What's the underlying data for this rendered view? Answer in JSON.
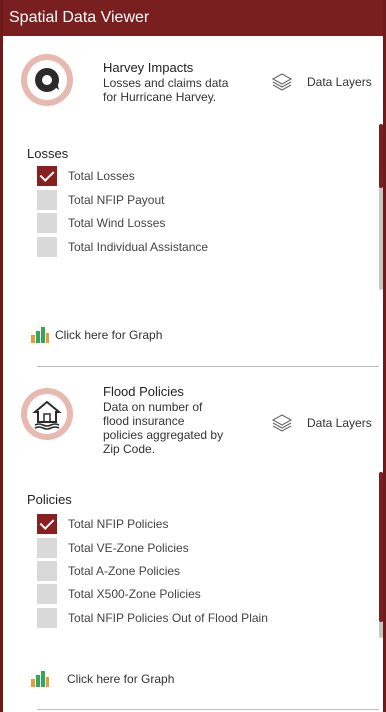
{
  "app": {
    "title": "Spatial Data Viewer"
  },
  "colors": {
    "accent": "#7a1f1f",
    "checkbox_checked": "#8a1f1f",
    "checkbox_unchecked": "#d9d9d9",
    "logo_ring": "#e7b9b0"
  },
  "cards": [
    {
      "icon": "hurricane-icon",
      "title": "Harvey Impacts",
      "description_lines": [
        "Losses and claims data",
        "for Hurricane Harvey."
      ],
      "layers_icon": "layers-icon",
      "layers_label": "Data Layers",
      "section_title": "Losses",
      "items": [
        {
          "label": "Total Losses",
          "checked": true
        },
        {
          "label": "Total NFIP Payout",
          "checked": false
        },
        {
          "label": "Total Wind Losses",
          "checked": false
        },
        {
          "label": "Total Individual Assistance",
          "checked": false
        }
      ],
      "graph_icon": "bar-chart-icon",
      "graph_label": "Click here for Graph"
    },
    {
      "icon": "house-flood-icon",
      "title": "Flood Policies",
      "description_lines": [
        "Data on number of",
        "flood insurance",
        "policies aggregated by",
        "Zip Code."
      ],
      "layers_icon": "layers-icon",
      "layers_label": "Data Layers",
      "section_title": "Policies",
      "items": [
        {
          "label": "Total NFIP Policies",
          "checked": true
        },
        {
          "label": "Total VE-Zone Policies",
          "checked": false
        },
        {
          "label": "Total A-Zone Policies",
          "checked": false
        },
        {
          "label": "Total X500-Zone Policies",
          "checked": false
        },
        {
          "label": "Total NFIP Policies Out of Flood Plain",
          "checked": false
        }
      ],
      "graph_icon": "bar-chart-icon",
      "graph_label": "Click here for Graph"
    }
  ]
}
